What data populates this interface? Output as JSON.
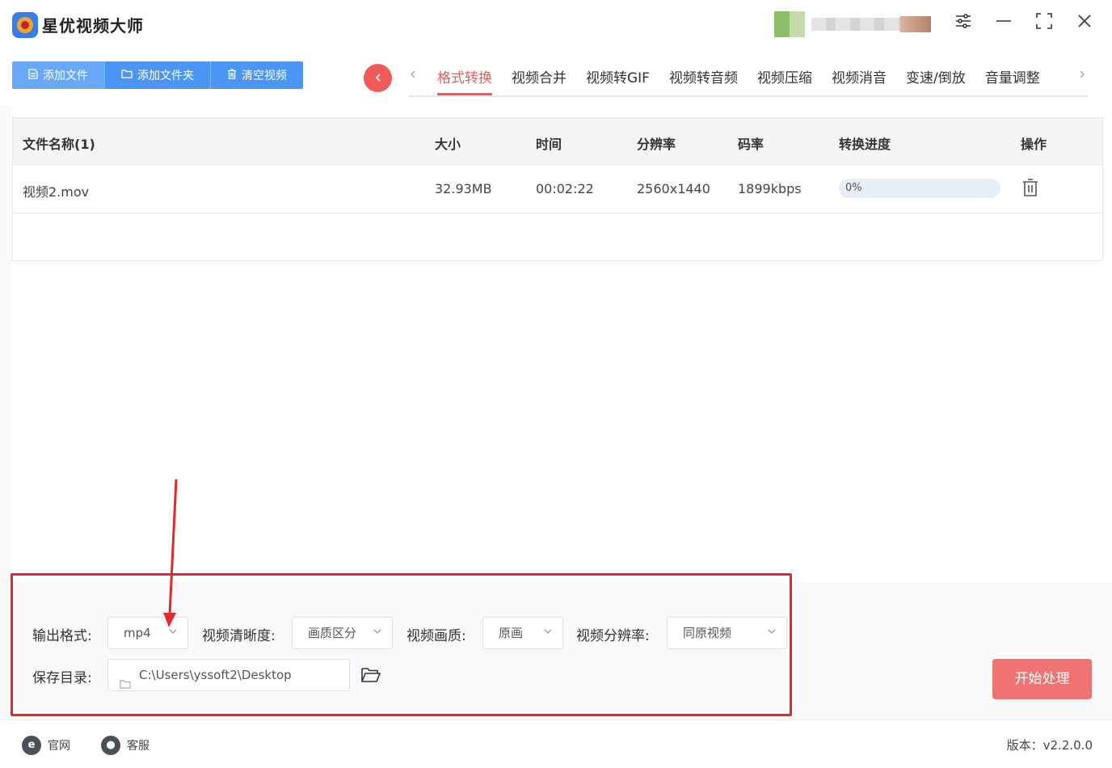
{
  "app": {
    "title": "星优视频大师"
  },
  "toolbar": {
    "add_file": "添加文件",
    "add_folder": "添加文件夹",
    "clear_videos": "清空视频"
  },
  "tabs": [
    {
      "label": "格式转换",
      "active": true
    },
    {
      "label": "视频合并",
      "active": false
    },
    {
      "label": "视频转GIF",
      "active": false
    },
    {
      "label": "视频转音频",
      "active": false
    },
    {
      "label": "视频压缩",
      "active": false
    },
    {
      "label": "视频消音",
      "active": false
    },
    {
      "label": "变速/倒放",
      "active": false
    },
    {
      "label": "音量调整",
      "active": false
    }
  ],
  "table": {
    "headers": {
      "name": "文件名称(1)",
      "size": "大小",
      "time": "时间",
      "resolution": "分辨率",
      "bitrate": "码率",
      "progress": "转换进度",
      "action": "操作"
    },
    "rows": [
      {
        "name": "视频2.mov",
        "size": "32.93MB",
        "time": "00:02:22",
        "resolution": "2560x1440",
        "bitrate": "1899kbps",
        "progress_text": "0%",
        "progress_value": 0
      }
    ]
  },
  "settings": {
    "output_format_label": "输出格式:",
    "output_format_value": "mp4",
    "clarity_label": "视频清晰度:",
    "clarity_value": "画质区分",
    "quality_label": "视频画质:",
    "quality_value": "原画",
    "resolution_label": "视频分辨率:",
    "resolution_value": "同原视频",
    "save_dir_label": "保存目录:",
    "save_dir_value": "C:\\Users\\yssoft2\\Desktop",
    "start_button": "开始处理"
  },
  "statusbar": {
    "website": "官网",
    "support": "客服",
    "version": "版本：v2.2.0.0"
  },
  "colors": {
    "accent_red": "#ef5a5a",
    "toolbar_blue": "#4b96f4",
    "annotation_red": "#e02a2a",
    "start_button": "#f07373"
  }
}
